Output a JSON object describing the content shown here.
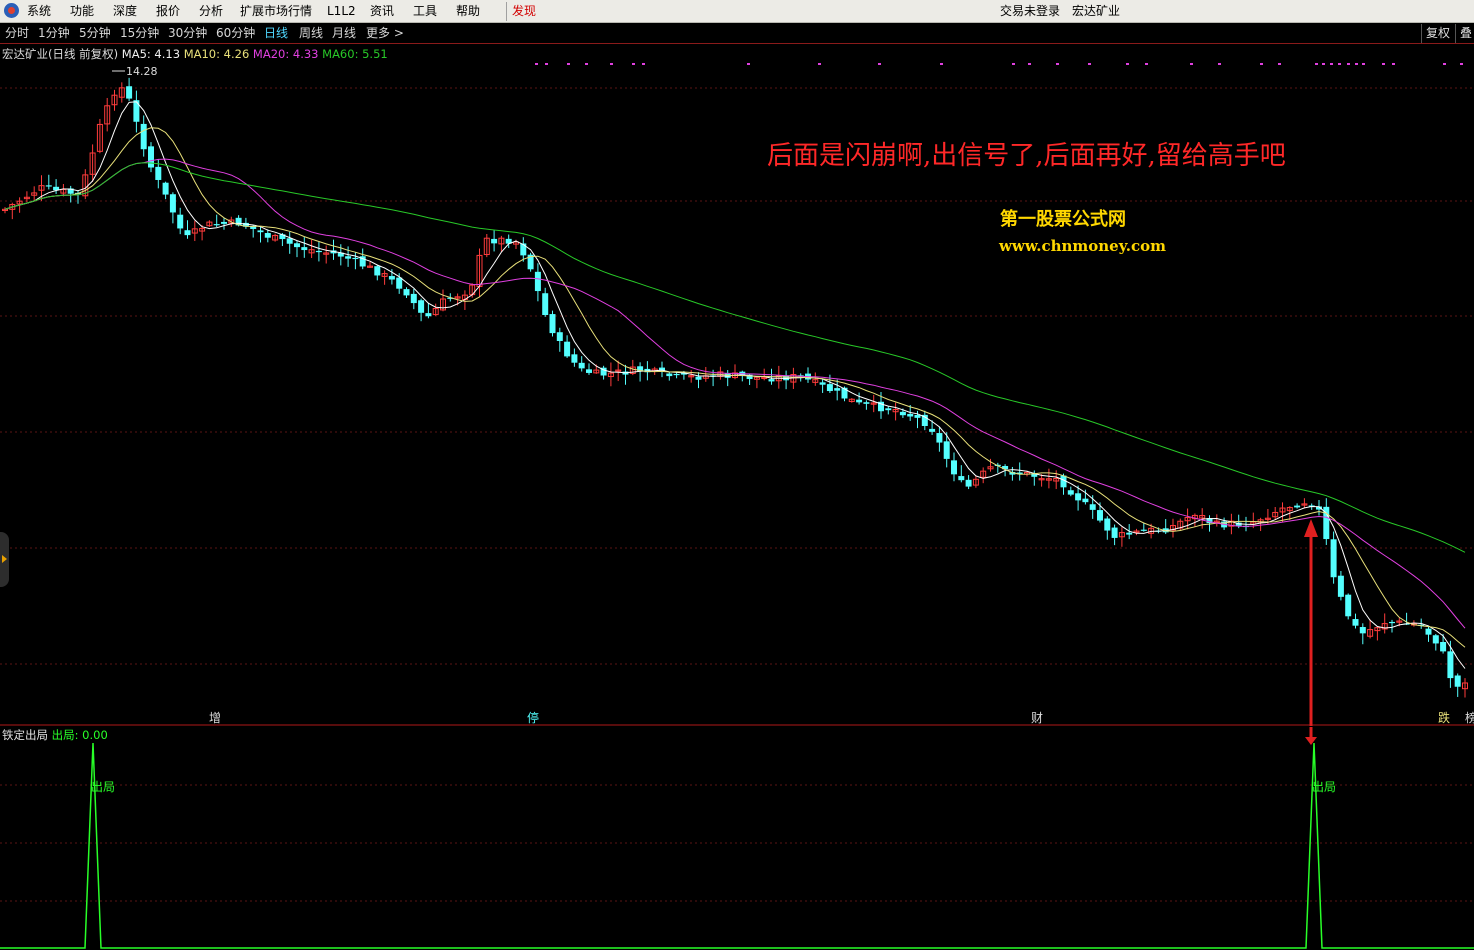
{
  "menu": {
    "items": [
      "系统",
      "功能",
      "深度",
      "报价",
      "分析",
      "扩展市场行情",
      "L1L2",
      "资讯",
      "工具",
      "帮助"
    ],
    "found_label": "发现",
    "status_login": "交易未登录",
    "status_stock": "宏达矿业"
  },
  "period_bar": {
    "items": [
      "分时",
      "1分钟",
      "5分钟",
      "15分钟",
      "30分钟",
      "60分钟",
      "日线",
      "周线",
      "月线",
      "更多 >"
    ],
    "active_index": 6,
    "right_buttons": [
      "复权",
      "叠"
    ]
  },
  "main_chart": {
    "title": "宏达矿业(日线 前复权)",
    "ma5_label": "MA5: 4.13",
    "ma10_label": "MA10: 4.26",
    "ma20_label": "MA20: 4.33",
    "ma60_label": "MA60: 5.51",
    "high_marker": "14.28",
    "annotation": "后面是闪崩啊,出信号了,后面再好,留给高手吧",
    "watermark_title": "第一股票公式网",
    "watermark_url": "www.chnmoney.com",
    "event_labels": [
      "增",
      "停",
      "财",
      "跌",
      "榜"
    ],
    "colors": {
      "up": "#ff3c3c",
      "down": "#54ffff",
      "ma5": "#ffffff",
      "ma10": "#e8e07a",
      "ma20": "#e040e0",
      "ma60": "#28c828",
      "annotation": "#ff2828",
      "watermark": "#ffd700"
    }
  },
  "sub_chart": {
    "indicator_name": "铁定出局",
    "value_label": "出局: 0.00",
    "signal_label": "出局",
    "signal_color": "#28ff28"
  }
}
